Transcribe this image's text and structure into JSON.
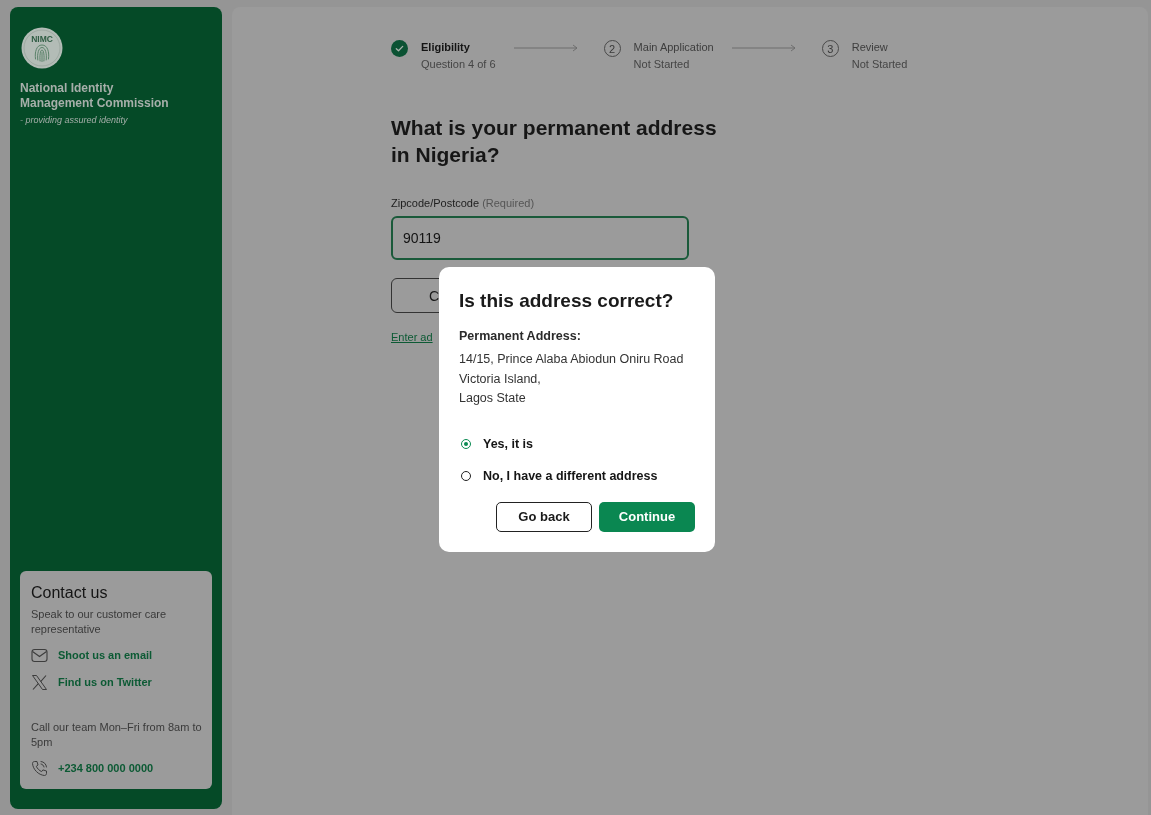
{
  "sidebar": {
    "logo_text": "NIMC",
    "org_name": "National Identity Management Commission",
    "tagline": "- providing assured identity",
    "contact": {
      "title": "Contact us",
      "subtitle": "Speak to our customer care representative",
      "links": [
        {
          "kind": "email",
          "label": "Shoot us an email"
        },
        {
          "kind": "twitter",
          "label": "Find us on Twitter"
        }
      ],
      "hours": "Call our team Mon–Fri from 8am to 5pm",
      "phone": "+234 800 000 0000"
    }
  },
  "steps": [
    {
      "title": "Eligibility",
      "status": "Question 4 of 6",
      "done": true
    },
    {
      "number": "2",
      "title": "Main Application",
      "status": "Not Started",
      "done": false
    },
    {
      "number": "3",
      "title": "Review",
      "status": "Not Started",
      "done": false
    }
  ],
  "form": {
    "question": "What is your permanent address in Nigeria?",
    "field": {
      "label": "Zipcode/Postcode",
      "hint": "(Required)",
      "value": "90119",
      "focused": true
    },
    "button": {
      "label": "C"
    },
    "link": "Enter ad"
  },
  "dialog": {
    "title": "Is this address correct?",
    "address_label": "Permanent Address:",
    "address_lines": [
      "14/15, Prince Alaba Abiodun Oniru Road",
      "Victoria Island,",
      "Lagos State"
    ],
    "options": [
      {
        "label": "Yes, it is",
        "selected": true
      },
      {
        "label": "No, I have a different address",
        "selected": false
      }
    ],
    "buttons": [
      {
        "kind": "secondary",
        "label": "Go back"
      },
      {
        "kind": "primary",
        "label": "Continue"
      }
    ]
  }
}
